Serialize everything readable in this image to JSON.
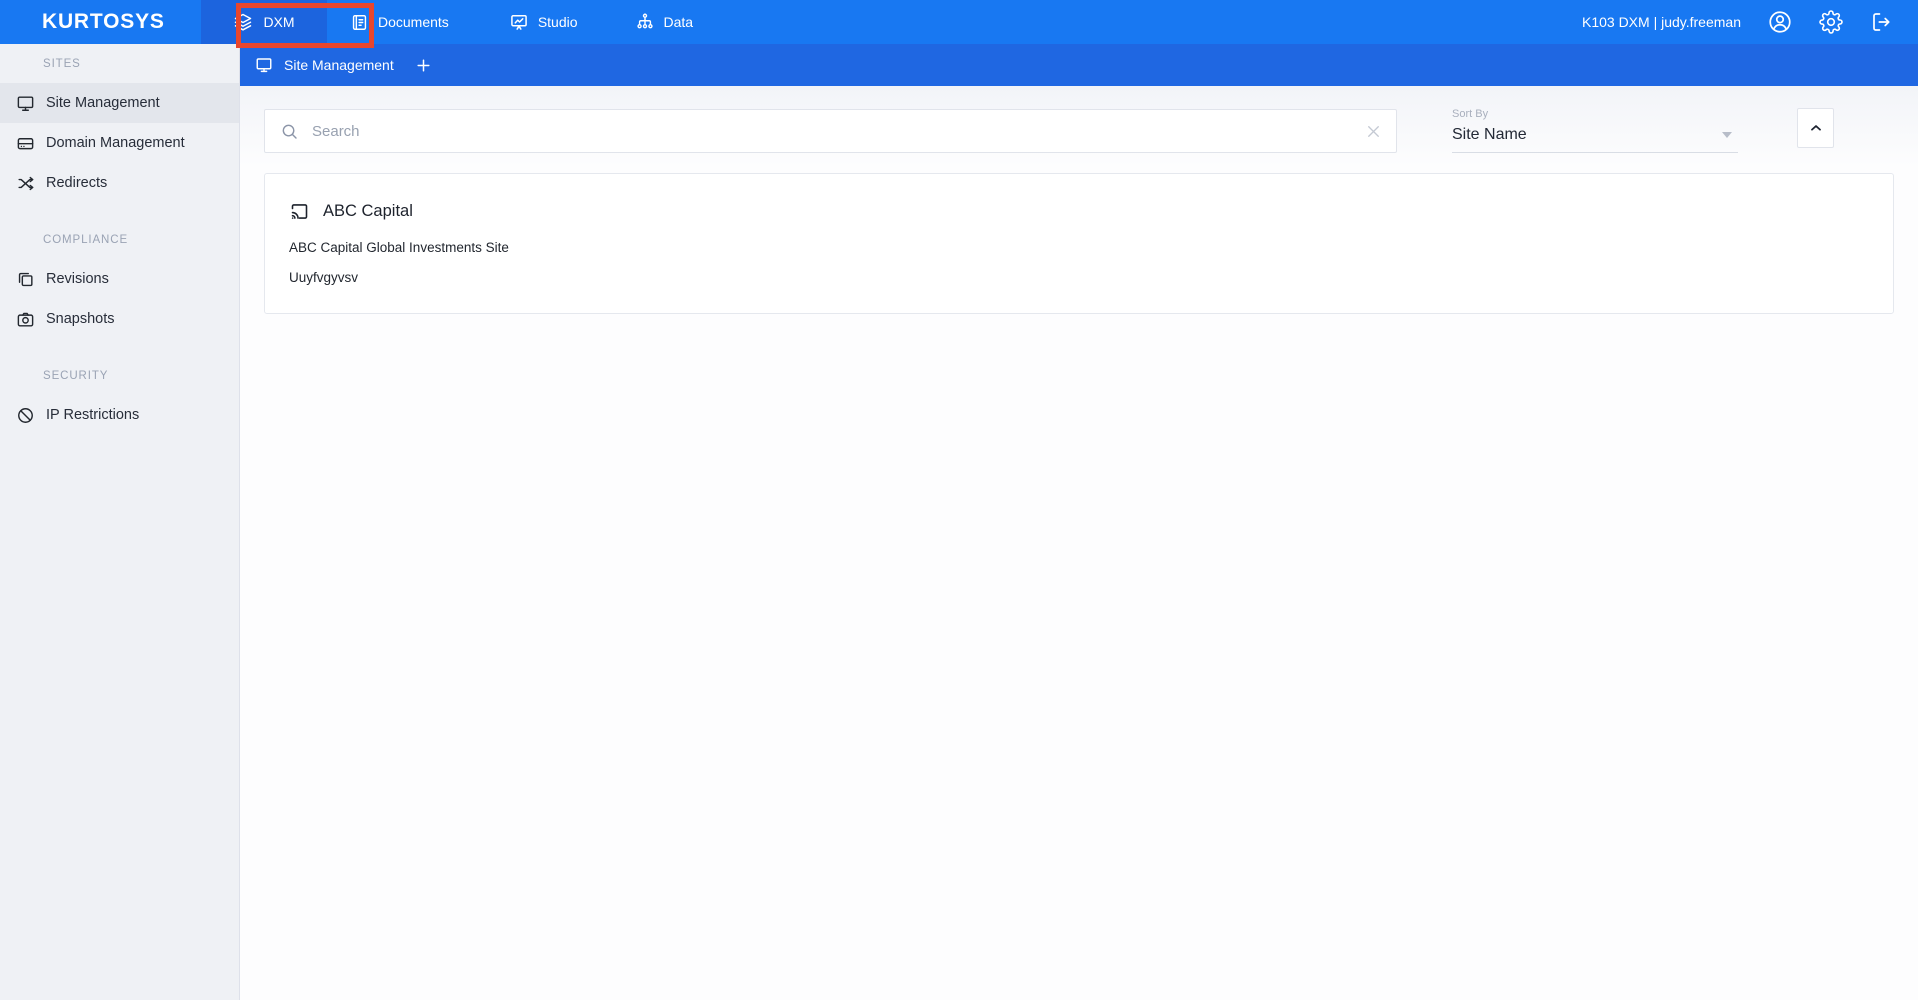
{
  "brand": {
    "logo": "KURTOSYS"
  },
  "header": {
    "nav": [
      {
        "label": "DXM",
        "icon": "layers-icon"
      },
      {
        "label": "Documents",
        "icon": "documents-icon"
      },
      {
        "label": "Studio",
        "icon": "studio-icon"
      },
      {
        "label": "Data",
        "icon": "data-icon"
      }
    ],
    "account_label": "K103 DXM | judy.freeman"
  },
  "tabbar": {
    "active_tab": "Site Management"
  },
  "sidebar": {
    "sections": [
      {
        "title": "SITES",
        "items": [
          {
            "label": "Site Management",
            "icon": "monitor-icon",
            "active": true
          },
          {
            "label": "Domain Management",
            "icon": "domain-icon",
            "active": false
          },
          {
            "label": "Redirects",
            "icon": "redirects-icon",
            "active": false
          }
        ]
      },
      {
        "title": "COMPLIANCE",
        "items": [
          {
            "label": "Revisions",
            "icon": "revisions-icon",
            "active": false
          },
          {
            "label": "Snapshots",
            "icon": "camera-icon",
            "active": false
          }
        ]
      },
      {
        "title": "SECURITY",
        "items": [
          {
            "label": "IP Restrictions",
            "icon": "ban-icon",
            "active": false
          }
        ]
      }
    ]
  },
  "main": {
    "search": {
      "placeholder": "Search"
    },
    "sort": {
      "label": "Sort By",
      "value": "Site Name"
    },
    "cards": [
      {
        "title": "ABC Capital",
        "description": "ABC Capital Global Investments Site",
        "subtitle": "Uuyfvgyvsv",
        "icon": "cast-icon"
      }
    ]
  },
  "colors": {
    "header_blue": "#1878F2",
    "tabbar_blue": "#1F67E2",
    "active_nav_tab_blue": "#1C64DE",
    "annotation_red": "#E8462D",
    "sidebar_bg": "#EFF1F5",
    "active_item_bg": "#E3E6EC"
  }
}
